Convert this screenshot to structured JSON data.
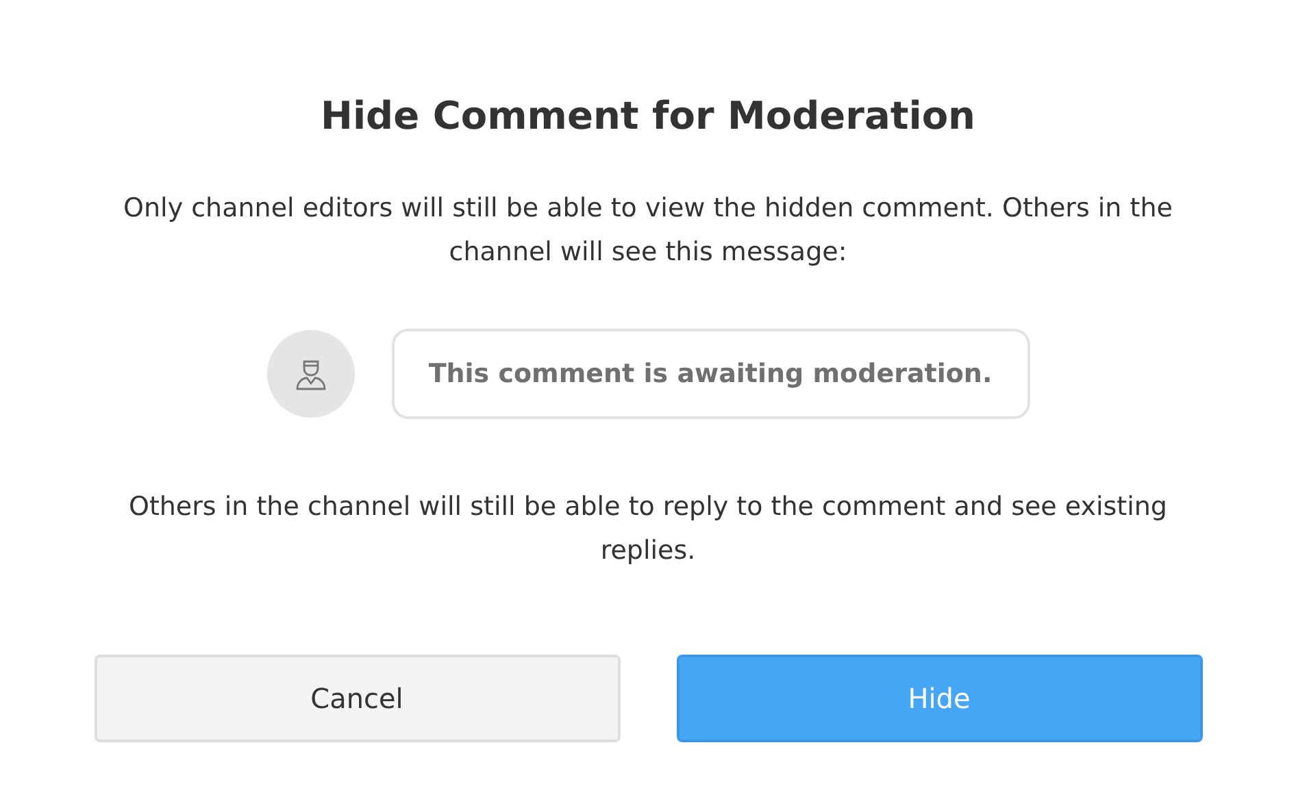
{
  "dialog": {
    "title": "Hide Comment for Moderation",
    "description": "Only channel editors will still be able to view the hidden comment. Others in the channel will see this message:",
    "preview_message": "This comment is awaiting moderation.",
    "note": "Others in the channel will still be able to reply to the comment and see existing replies.",
    "buttons": [
      {
        "label": "Cancel",
        "kind": "secondary"
      },
      {
        "label": "Hide",
        "kind": "primary"
      }
    ]
  }
}
